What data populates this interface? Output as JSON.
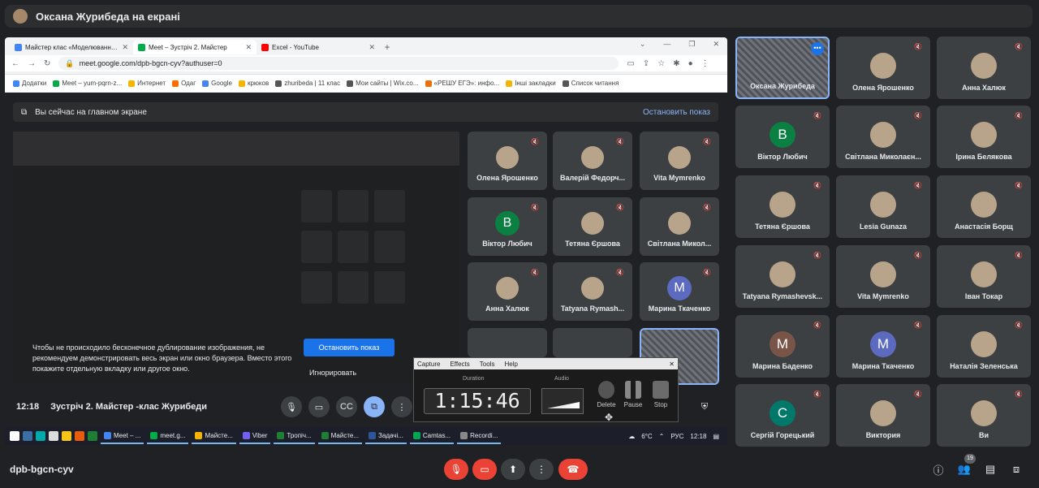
{
  "presenter": {
    "title": "Оксана Журибеда на екрані"
  },
  "browser": {
    "tabs": [
      {
        "label": "Майстер клас «Моделювання »",
        "color": "#4285f4",
        "active": false
      },
      {
        "label": "Meet – Зустріч 2. Майстер",
        "color": "#00ac47",
        "active": true
      },
      {
        "label": "Excel - YouTube",
        "color": "#ff0000",
        "active": false
      }
    ],
    "url": "meet.google.com/dpb-bgcn-cyv?authuser=0",
    "bookmarks": [
      "Додатки",
      "Meet – yum-pqrn-z...",
      "Интернет",
      "Одаг",
      "Google",
      "крюков",
      "zhuribeda | 11 клас",
      "Мои сайты | Wix.co...",
      "«РЕШУ ЕГЭ»: инфо...",
      "Інші закладки",
      "Список читання"
    ]
  },
  "onscreen": {
    "label": "Вы сейчас на главном экране",
    "stop_label": "Остановить показ"
  },
  "warning": {
    "text": "Чтобы не происходило бесконечное дублирование изображения, не рекомендуем демонстрировать весь экран или окно браузера. Вместо этого покажите отдельную вкладку или другое окно.",
    "stop_button": "Остановить показ",
    "ignore_button": "Игнорировать"
  },
  "inner_tiles": [
    {
      "name": "Олена Ярошенко",
      "type": "photo"
    },
    {
      "name": "Валерій Федорч...",
      "type": "photo"
    },
    {
      "name": "Vita Mymrenko",
      "type": "photo"
    },
    {
      "name": "Віктор Любич",
      "type": "letter",
      "letter": "В",
      "color": "#0b8043"
    },
    {
      "name": "Тетяна Єршова",
      "type": "photo"
    },
    {
      "name": "Світлана Микол...",
      "type": "photo"
    },
    {
      "name": "Анна Халюк",
      "type": "photo"
    },
    {
      "name": "Tatyana Rymash...",
      "type": "photo"
    },
    {
      "name": "Марина Ткаченко",
      "type": "letter",
      "letter": "М",
      "color": "#5c6bc0"
    }
  ],
  "inner_meeting": {
    "time": "12:18",
    "title": "Зустріч 2. Майстер -клас Журибеди"
  },
  "taskbar": {
    "apps": [
      "Meet – ...",
      "meet.g...",
      "Майсте...",
      "Viber",
      "Тропіч...",
      "Майсте...",
      "Задачі...",
      "Camtas...",
      "Recordi..."
    ],
    "weather": "6°C",
    "lang": "РУС",
    "time": "12:18"
  },
  "camtasia": {
    "menu": [
      "Capture",
      "Effects",
      "Tools",
      "Help"
    ],
    "duration_label": "Duration",
    "duration": "1:15:46",
    "audio_label": "Audio",
    "delete_label": "Delete",
    "pause_label": "Pause",
    "stop_label": "Stop"
  },
  "participants": [
    {
      "name": "Оксана Журибеда",
      "type": "self"
    },
    {
      "name": "Олена Ярошенко",
      "type": "photo"
    },
    {
      "name": "Анна Халюк",
      "type": "photo"
    },
    {
      "name": "Віктор Любич",
      "type": "letter",
      "letter": "В",
      "color": "#0b8043"
    },
    {
      "name": "Світлана Миколаєн...",
      "type": "photo"
    },
    {
      "name": "Ірина Белякова",
      "type": "photo"
    },
    {
      "name": "Тетяна Єршова",
      "type": "photo"
    },
    {
      "name": "Lesia Gunaza",
      "type": "photo"
    },
    {
      "name": "Анастасія Борщ",
      "type": "photo"
    },
    {
      "name": "Tatyana Rymashevsk...",
      "type": "photo"
    },
    {
      "name": "Vita Mymrenko",
      "type": "photo"
    },
    {
      "name": "Іван Токар",
      "type": "photo"
    },
    {
      "name": "Марина Баденко",
      "type": "letter",
      "letter": "М",
      "color": "#795548"
    },
    {
      "name": "Марина Ткаченко",
      "type": "letter",
      "letter": "М",
      "color": "#5c6bc0"
    },
    {
      "name": "Наталія Зеленська",
      "type": "photo"
    },
    {
      "name": "Сергій Горецький",
      "type": "letter",
      "letter": "С",
      "color": "#00796b"
    },
    {
      "name": "Виктория",
      "type": "photo"
    },
    {
      "name": "Ви",
      "type": "photo"
    }
  ],
  "meeting": {
    "code": "dpb-bgcn-cyv",
    "participant_count": "19"
  },
  "colors": {
    "end_call": "#ea4335",
    "accent": "#8ab4f8",
    "tile": "#3c4043"
  }
}
